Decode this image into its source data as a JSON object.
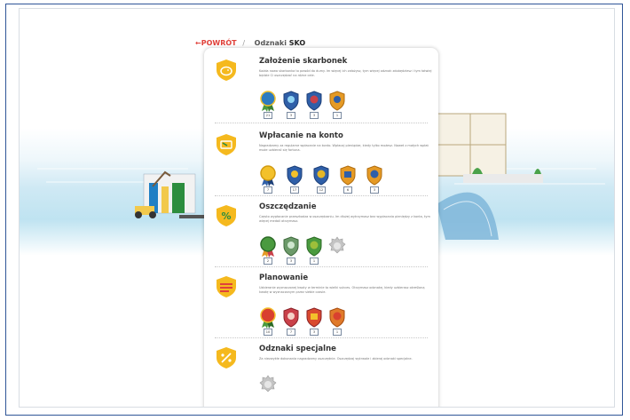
{
  "nav": {
    "back_arrow": "←",
    "back_label": "POWRÓT",
    "separator": "/",
    "breadcrumb_prefix": "Odznaki ",
    "breadcrumb_bold": "SKO"
  },
  "sections": [
    {
      "title": "Założenie skarbonek",
      "desc": "Każda nowa skarbonka to powód do dumy. Im więcej ich założysz, tym więcej odznak zdobędziesz i tym łatwiej będzie Ci oszczędzać na różne cele.",
      "icon": "piggy-icon",
      "badges": [
        {
          "count": "21",
          "color": "#2e7bbf"
        },
        {
          "count": "3",
          "color": "#2f5fa8"
        },
        {
          "count": "3",
          "color": "#c9414a"
        },
        {
          "count": "1",
          "color": "#e59a25"
        }
      ]
    },
    {
      "title": "Wpłacanie na konto",
      "desc": "Nagradzamy za regularne wpłacanie na konto. Wpłacaj pieniądze, kiedy tylko możesz. Nawet z małych wpłat może uzbierać się fortuna.",
      "icon": "deposit-icon",
      "badges": [
        {
          "count": "7",
          "color": "#f3c12b"
        },
        {
          "count": "17",
          "color": "#2f5fa8"
        },
        {
          "count": "12",
          "color": "#e5b626"
        },
        {
          "count": "6",
          "color": "#e59a25"
        },
        {
          "count": "3",
          "color": "#2f5fa8"
        }
      ]
    },
    {
      "title": "Oszczędzanie",
      "desc": "Często wypłacanie przeszkadza w oszczędzaniu. Im dłużej wytrzymasz bez wypłacania pieniędzy z konta, tym więcej medali otrzymasz.",
      "icon": "percent-icon",
      "badges": [
        {
          "count": "2",
          "color": "#4a9a3f"
        },
        {
          "count": "3",
          "color": "#6c9a6a"
        },
        {
          "count": "1",
          "color": "#9dbf3a"
        },
        {
          "count": "",
          "color": "#b8b8b8"
        }
      ]
    },
    {
      "title": "Planowanie",
      "desc": "Uzbieranie wyznaczonej kwoty w terminie to wielki sukces. Otrzymasz odznakę, kiedy uzbierasz określoną kwotę w wyznaczonym przez siebie czasie.",
      "icon": "plan-icon",
      "badges": [
        {
          "count": "10",
          "color": "#d9412f"
        },
        {
          "count": "7",
          "color": "#c9414a"
        },
        {
          "count": "3",
          "color": "#d94a2f"
        },
        {
          "count": "1",
          "color": "#e07a2a"
        }
      ]
    },
    {
      "title": "Odznaki specjalne",
      "desc": "Za niezwykłe dokonania nagradzamy oszczędnie. Oszczędzaj wytrwale i zbieraj odznaki specjalne.",
      "icon": "special-icon",
      "badges": [
        {
          "count": "",
          "color": "#b8b8b8"
        }
      ]
    }
  ]
}
